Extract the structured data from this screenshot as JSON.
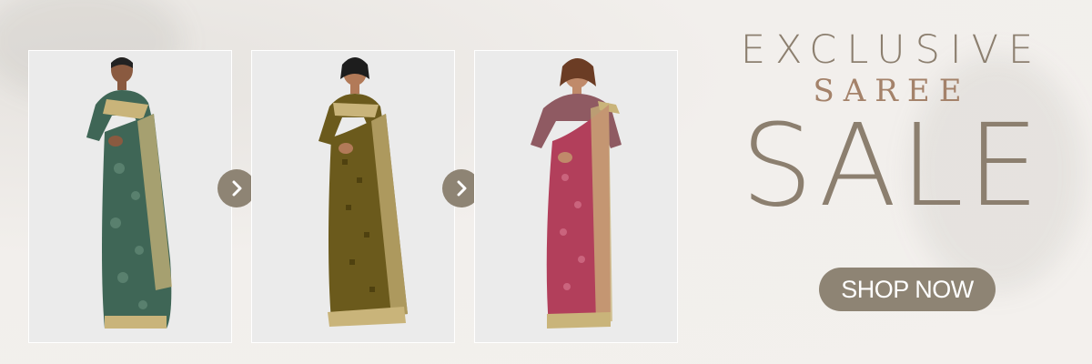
{
  "headline": {
    "line1": "EXCLUSIVE",
    "line2": "SAREE",
    "line3": "SALE"
  },
  "cta": {
    "label": "SHOP NOW"
  },
  "icons": {
    "next": "chevron-right-icon"
  },
  "colors": {
    "accent": "#8e8474",
    "heading": "#8c7f6f",
    "saree_text": "#a4826a",
    "background": "#f2efec",
    "saree_green": "#3f6656",
    "saree_olive": "#6b5a1c",
    "saree_pink": "#b23f5b",
    "border_gold": "#c9b47a"
  }
}
